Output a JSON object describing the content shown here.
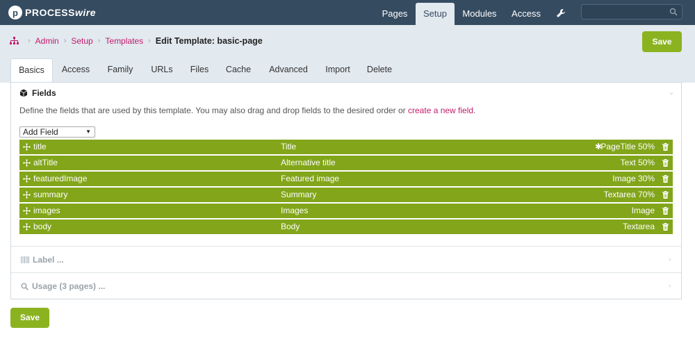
{
  "brand": {
    "mark": "p",
    "name_a": "PROCESS",
    "name_b": "wire"
  },
  "topnav": [
    {
      "label": "Pages",
      "active": false
    },
    {
      "label": "Setup",
      "active": true
    },
    {
      "label": "Modules",
      "active": false
    },
    {
      "label": "Access",
      "active": false
    }
  ],
  "icons": {
    "settings": "wrench-icon",
    "search": "search-icon",
    "home": "sitemap-icon"
  },
  "search": {
    "placeholder": ""
  },
  "breadcrumb": {
    "items": [
      "Admin",
      "Setup",
      "Templates"
    ],
    "separator": "›",
    "current": "Edit Template: basic-page"
  },
  "save_label": "Save",
  "tabs": [
    "Basics",
    "Access",
    "Family",
    "URLs",
    "Files",
    "Cache",
    "Advanced",
    "Import",
    "Delete"
  ],
  "fields_section": {
    "title": "Fields",
    "description": "Define the fields that are used by this template. You may also drag and drop fields to the desired order or ",
    "link_text": "create a new field",
    "description_end": ".",
    "add_field": "Add Field",
    "rows": [
      {
        "name": "title",
        "label": "Title",
        "type": "PageTitle 50%",
        "gear": true
      },
      {
        "name": "altTitle",
        "label": "Alternative title",
        "type": "Text 50%",
        "gear": false
      },
      {
        "name": "featuredImage",
        "label": "Featured image",
        "type": "Image 30%",
        "gear": false
      },
      {
        "name": "summary",
        "label": "Summary",
        "type": "Textarea 70%",
        "gear": false
      },
      {
        "name": "images",
        "label": "Images",
        "type": "Image",
        "gear": false
      },
      {
        "name": "body",
        "label": "Body",
        "type": "Textarea",
        "gear": false
      }
    ]
  },
  "label_section": {
    "title": "Label ..."
  },
  "usage_section": {
    "title": "Usage (3 pages) ..."
  },
  "colors": {
    "topbar": "#354b60",
    "band": "#e2e9ef",
    "accent": "#8bb320",
    "field_row": "#82a51a",
    "link": "#c21a6d"
  }
}
